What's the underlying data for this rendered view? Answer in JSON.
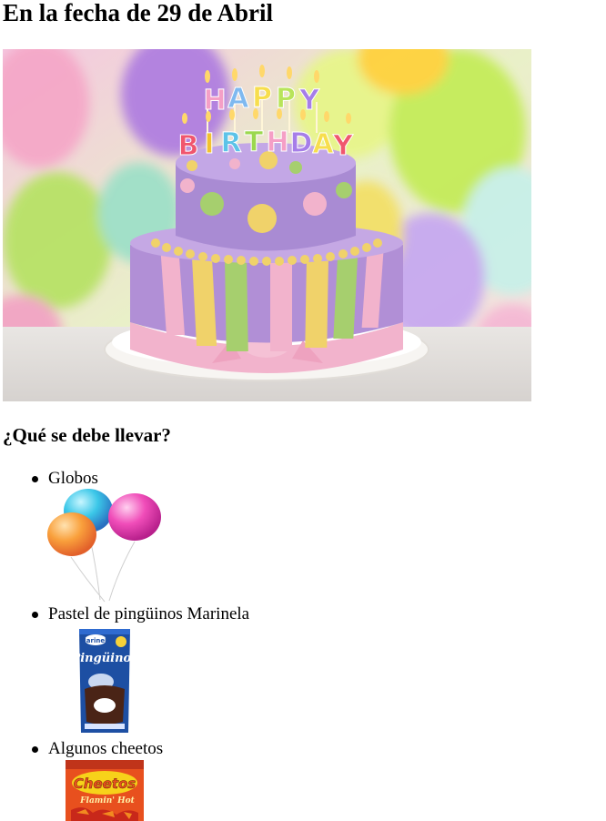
{
  "page": {
    "title": "En la fecha de 29 de Abril",
    "hero_image": {
      "topper_row1": [
        "H",
        "A",
        "P",
        "P",
        "Y"
      ],
      "topper_row2": [
        "B",
        "I",
        "R",
        "T",
        "H",
        "D",
        "A",
        "Y"
      ]
    },
    "question": "¿Qué se debe llevar?",
    "items": [
      {
        "label": "Globos",
        "image": "balloons"
      },
      {
        "label": "Pastel de pingüinos Marinela",
        "image": "pinguinos-package",
        "package_text": "Pingüinos",
        "brand_text": "Marinela"
      },
      {
        "label": "Algunos cheetos",
        "image": "cheetos-bag",
        "package_text": "Cheetos",
        "sub_text": "Flamin' Hot"
      }
    ]
  },
  "colors": {
    "cake_lavender": "#b18fd6",
    "cake_pink": "#f2b3cc",
    "cake_yellow": "#f0d26a",
    "cake_green": "#a6cf6e",
    "pinguinos_blue": "#1d4fa3",
    "cheetos_orange": "#f07d1a"
  }
}
